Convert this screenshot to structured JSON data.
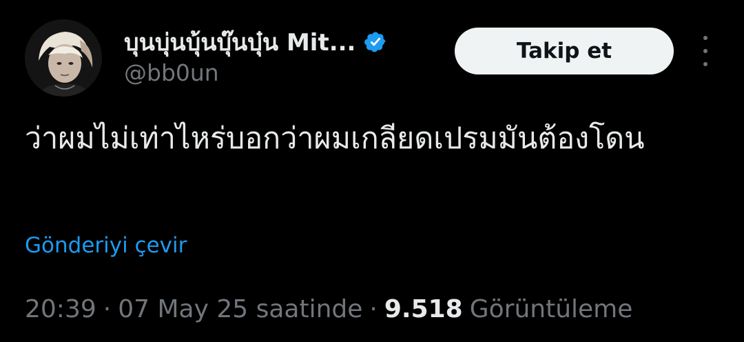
{
  "user": {
    "display_name": "บุนบุ่นบุ้นบุ๊นบุ๋น Mit...",
    "handle": "@bb0un",
    "verified": true,
    "verified_color": "#1d9bf0",
    "avatar_icon": "profile-photo"
  },
  "actions": {
    "follow_label": "Takip et",
    "more_icon": "more-vertical-icon"
  },
  "tweet": {
    "text": "ว่าผมไม่เท่าไหร่บอกว่าผมเกลียดเปรมมันต้องโดน",
    "translate_label": "Gönderiyi çevir",
    "time": "20:39",
    "date": "07 May 25 saatinde",
    "separator": "·",
    "views_count": "9.518",
    "views_label": "Görüntüleme"
  },
  "colors": {
    "background": "#000000",
    "text_primary": "#e7e9ea",
    "text_secondary": "#71767b",
    "link": "#1d9bf0",
    "button_bg": "#eff3f4"
  }
}
